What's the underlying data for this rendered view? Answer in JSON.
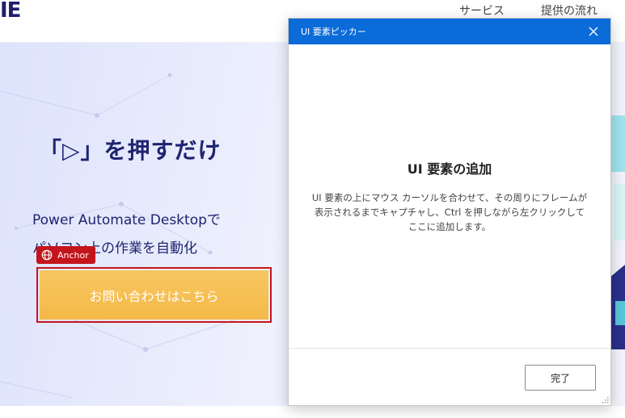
{
  "website": {
    "logo_fragment": "IE",
    "nav": [
      "サービス",
      "提供の流れ"
    ],
    "headline": "「▷」を押すだけ",
    "subline_1": "Power Automate Desktopで",
    "subline_2": "パソコン上の作業を自動化",
    "anchor_badge": "Anchor",
    "cta_label": "お問い合わせはこちら"
  },
  "dialog": {
    "title": "UI 要素ピッカー",
    "heading": "UI 要素の追加",
    "description": "UI 要素の上にマウス カーソルを合わせて、その周りにフレームが表示されるまでキャプチャし、Ctrl を押しながら左クリックしてここに追加します。",
    "done_label": "完了"
  },
  "colors": {
    "title_bar": "#0b6bd9",
    "anchor_red": "#c4151c",
    "cta_orange": "#f5be52",
    "headline_navy": "#1e2470"
  }
}
